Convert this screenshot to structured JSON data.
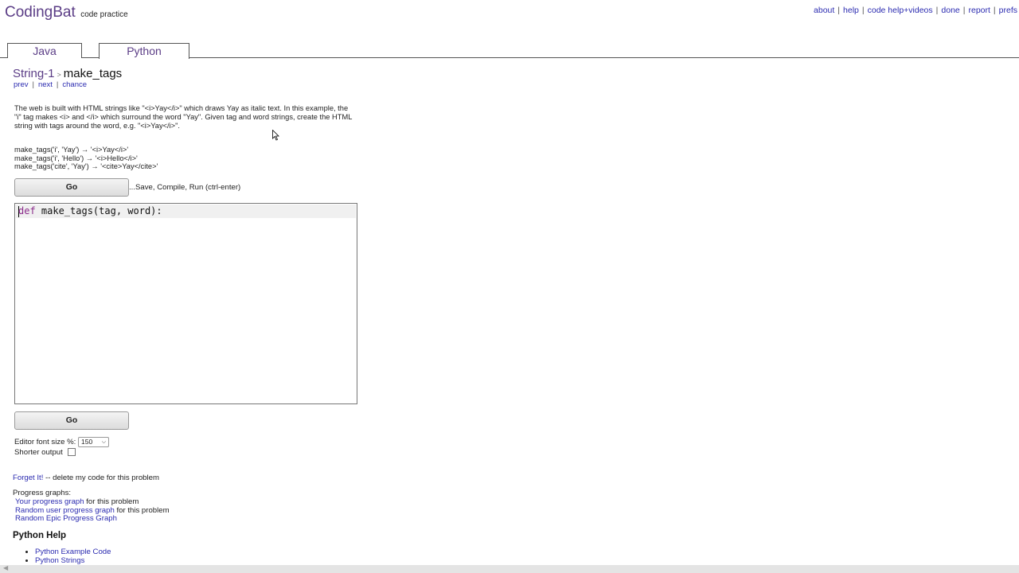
{
  "brand": {
    "logo": "CodingBat",
    "tagline": "code practice"
  },
  "topnav": [
    "about",
    "help",
    "code help+videos",
    "done",
    "report",
    "prefs"
  ],
  "tabs": [
    {
      "label": "Java"
    },
    {
      "label": "Python",
      "active": true
    }
  ],
  "problem": {
    "section": "String-1",
    "separator": ">",
    "name": "make_tags",
    "nav": [
      "prev",
      "next",
      "chance"
    ],
    "description": "The web is built with HTML strings like \"<i>Yay</i>\" which draws Yay as italic text. In this example, the \"i\" tag makes <i> and </i> which surround the word \"Yay\". Given tag and word strings, create the HTML string with tags around the word, e.g. \"<i>Yay</i>\".",
    "examples": [
      "make_tags('i', 'Yay') → '<i>Yay</i>'",
      "make_tags('i', 'Hello') → '<i>Hello</i>'",
      "make_tags('cite', 'Yay') → '<cite>Yay</cite>'"
    ]
  },
  "go_label": "Go",
  "save_hint": "...Save, Compile, Run (ctrl-enter)",
  "editor": {
    "keyword": "def",
    "rest": " make_tags(tag, word):"
  },
  "options": {
    "font_size_label": "Editor font size %:",
    "font_size_value": "150",
    "shorter_output_label": "Shorter output",
    "shorter_output_checked": false
  },
  "forget": {
    "link": "Forget It!",
    "rest": " -- delete my code for this problem"
  },
  "progress": {
    "title": "Progress graphs:",
    "rows": [
      {
        "link": "Your progress graph",
        "rest": " for this problem"
      },
      {
        "link": "Random user progress graph",
        "rest": " for this problem"
      },
      {
        "link": "Random Epic Progress Graph",
        "rest": ""
      }
    ]
  },
  "python_help": {
    "title": "Python Help",
    "links": [
      "Python Example Code",
      "Python Strings"
    ]
  },
  "colors": {
    "brand": "#5b3d86",
    "link": "#2b2bb0",
    "keyword": "#8b2a8b"
  }
}
